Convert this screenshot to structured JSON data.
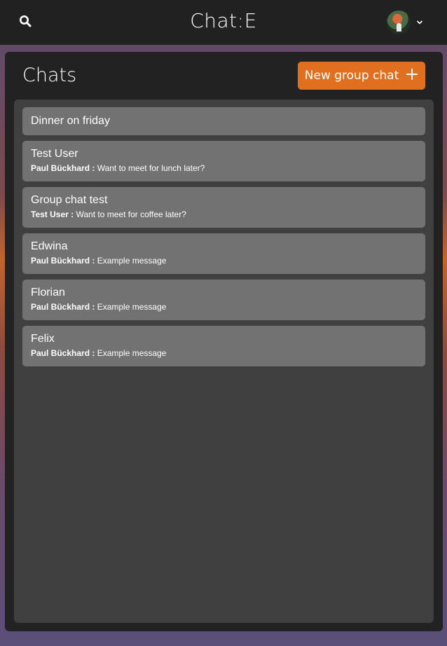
{
  "header": {
    "title": "Chat:E",
    "search_icon": "search-icon",
    "dropdown_icon": "chevron-down-icon"
  },
  "panel": {
    "title": "Chats",
    "new_group_label": "New group chat",
    "new_group_icon": "plus-icon"
  },
  "chats": [
    {
      "name": "Dinner on friday",
      "sender": "",
      "message": ""
    },
    {
      "name": "Test User",
      "sender": "Paul Bückhard :",
      "message": "Want to meet for lunch later?"
    },
    {
      "name": "Group chat test",
      "sender": "Test User :",
      "message": "Want to meet for coffee later?"
    },
    {
      "name": "Edwina",
      "sender": "Paul Bückhard :",
      "message": "Example message"
    },
    {
      "name": "Florian",
      "sender": "Paul Bückhard :",
      "message": "Example message"
    },
    {
      "name": "Felix",
      "sender": "Paul Bückhard :",
      "message": "Example message"
    }
  ],
  "colors": {
    "topbar": "#212121",
    "panel": "#222222",
    "list_area": "#404040",
    "chat_item": "#727272",
    "accent": "#e07020"
  }
}
